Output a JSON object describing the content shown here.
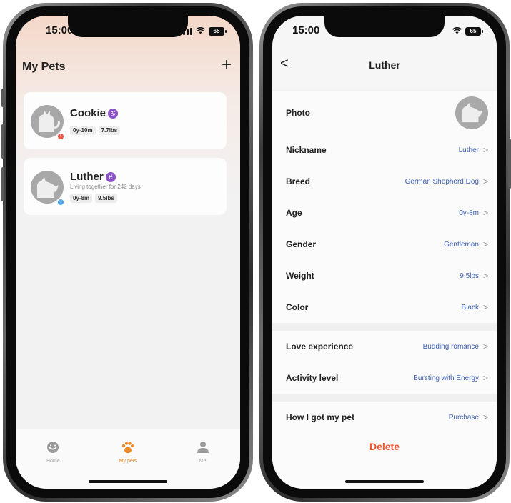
{
  "status_bar": {
    "left_time": "15:00",
    "right_time": "15:00",
    "battery": "65"
  },
  "pets_screen": {
    "title": "My Pets",
    "add_label": "+",
    "pets": [
      {
        "name": "Cookie",
        "zodiac": "♋",
        "gender": "♀",
        "gender_color": "#e85a4a",
        "subtitle": "",
        "age_tag": "0y-10m",
        "weight_tag": "7.7lbs"
      },
      {
        "name": "Luther",
        "zodiac": "♓",
        "gender": "♂",
        "gender_color": "#4aa3e8",
        "subtitle": "Living together for 242 days",
        "age_tag": "0y-8m",
        "weight_tag": "9.5lbs"
      }
    ],
    "tabs": [
      {
        "label": "Home",
        "icon": "home-bowl-icon"
      },
      {
        "label": "My pets",
        "icon": "paw-icon",
        "active": true
      },
      {
        "label": "Me",
        "icon": "person-icon"
      }
    ],
    "colors": {
      "accent": "#f08a24",
      "zodiac": "#8b52c9"
    }
  },
  "detail_screen": {
    "back_label": "<",
    "title": "Luther",
    "photo_label": "Photo",
    "rows": [
      {
        "label": "Nickname",
        "value": "Luther"
      },
      {
        "label": "Breed",
        "value": "German Shepherd Dog"
      },
      {
        "label": "Age",
        "value": "0y-8m"
      },
      {
        "label": "Gender",
        "value": "Gentleman"
      },
      {
        "label": "Weight",
        "value": "9.5lbs"
      },
      {
        "label": "Color",
        "value": "Black"
      }
    ],
    "rows2": [
      {
        "label": "Love experience",
        "value": "Budding romance"
      },
      {
        "label": "Activity level",
        "value": "Bursting with Energy"
      }
    ],
    "rows3": [
      {
        "label": "How I got my pet",
        "value": "Purchase"
      }
    ],
    "chevron": ">",
    "delete_label": "Delete",
    "colors": {
      "value_text": "#3d5fb3",
      "delete": "#f0552e"
    }
  }
}
